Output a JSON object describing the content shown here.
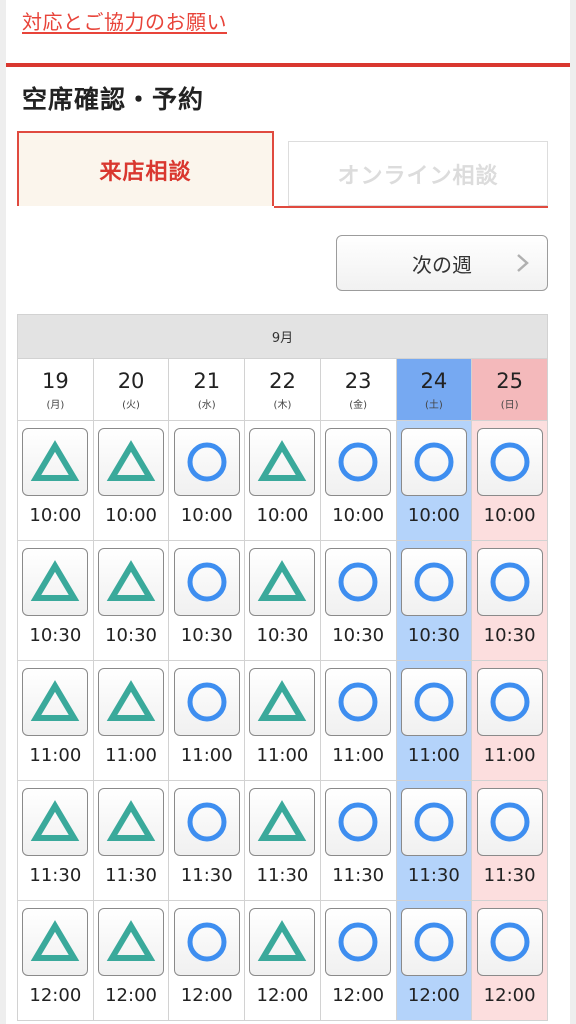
{
  "notice": {
    "link_text": "対応とご協力のお願い"
  },
  "section": {
    "title": "空席確認・予約"
  },
  "tabs": [
    {
      "label": "来店相談",
      "active": true
    },
    {
      "label": "オンライン相談",
      "active": false
    }
  ],
  "next_week": {
    "label": "次の週",
    "icon": "chevron-right-icon"
  },
  "calendar": {
    "month": "9月",
    "days": [
      {
        "num": "19",
        "weekday": "(月)",
        "type": "weekday"
      },
      {
        "num": "20",
        "weekday": "(火)",
        "type": "weekday"
      },
      {
        "num": "21",
        "weekday": "(水)",
        "type": "weekday"
      },
      {
        "num": "22",
        "weekday": "(木)",
        "type": "weekday"
      },
      {
        "num": "23",
        "weekday": "(金)",
        "type": "weekday"
      },
      {
        "num": "24",
        "weekday": "(土)",
        "type": "sat"
      },
      {
        "num": "25",
        "weekday": "(日)",
        "type": "sun"
      }
    ],
    "times": [
      "10:00",
      "10:30",
      "11:00",
      "11:30",
      "12:00"
    ],
    "availability_by_day": [
      "triangle",
      "triangle",
      "circle",
      "triangle",
      "circle",
      "circle",
      "circle"
    ],
    "legend_colors": {
      "triangle": "#3aa99b",
      "circle": "#3e8ef0"
    }
  },
  "colors": {
    "accent_red": "#d9372f",
    "saturday_blue": "#76a9f2",
    "sunday_pink": "#f4b9bb"
  }
}
